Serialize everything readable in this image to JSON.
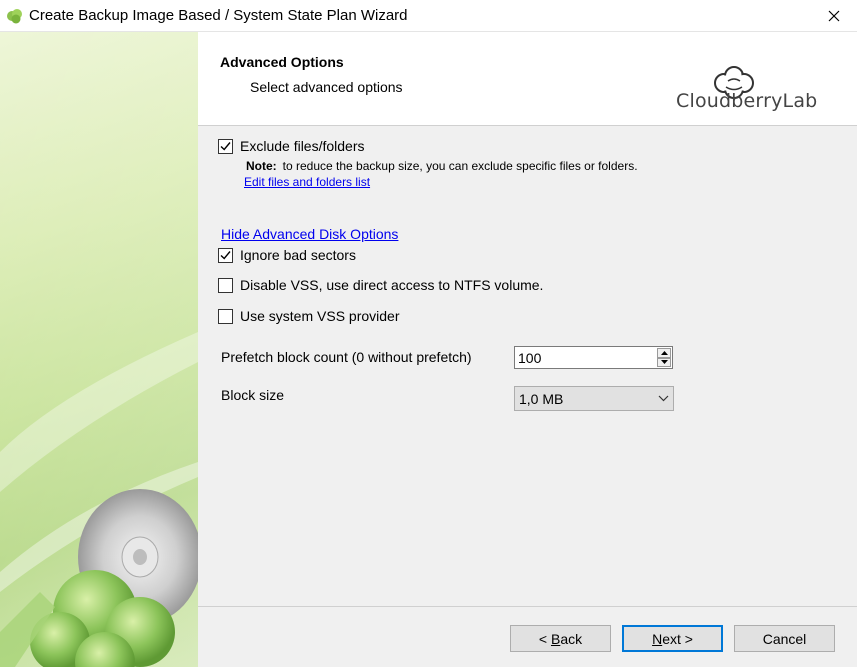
{
  "window": {
    "title": "Create Backup Image Based / System State Plan Wizard"
  },
  "header": {
    "title": "Advanced Options",
    "subtitle": "Select advanced options",
    "logo_text": "CloudberryLab"
  },
  "options": {
    "exclude": {
      "label": "Exclude files/folders",
      "checked": true
    },
    "note_label": "Note:",
    "note_text": "to reduce the backup size, you can exclude specific files or folders.",
    "edit_link": "Edit files and folders list",
    "hide_advanced_link": "Hide Advanced Disk Options",
    "ignore_bad_sectors": {
      "label": "Ignore bad sectors",
      "checked": true
    },
    "disable_vss": {
      "label": "Disable VSS, use direct access to NTFS volume.",
      "checked": false
    },
    "system_vss": {
      "label": "Use system VSS provider",
      "checked": false
    },
    "prefetch": {
      "label": "Prefetch block count (0 without prefetch)",
      "value": "100"
    },
    "block_size": {
      "label": "Block size",
      "selected": "1,0 MB"
    }
  },
  "footer": {
    "back_prefix": "< ",
    "back_mnemonic": "B",
    "back_rest": "ack",
    "next_mnemonic": "N",
    "next_rest": "ext >",
    "cancel_label": "Cancel"
  },
  "colors": {
    "link": "#0000ee",
    "primary_border": "#0078d7",
    "sidebar_green": "#c8e39a"
  }
}
